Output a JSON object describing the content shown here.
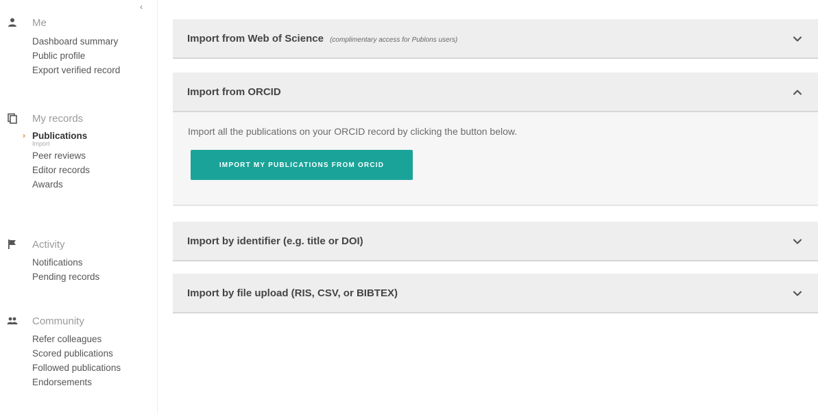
{
  "sidebar": {
    "collapse_glyph": "‹",
    "groups": [
      {
        "label": "Me",
        "icon": "person-icon",
        "items": [
          {
            "label": "Dashboard summary"
          },
          {
            "label": "Public profile"
          },
          {
            "label": "Export verified record"
          }
        ]
      },
      {
        "label": "My records",
        "icon": "records-icon",
        "items": [
          {
            "label": "Publications",
            "active": true,
            "sub": "Import"
          },
          {
            "label": "Peer reviews"
          },
          {
            "label": "Editor records"
          },
          {
            "label": "Awards"
          }
        ]
      },
      {
        "label": "Activity",
        "icon": "flag-icon",
        "items": [
          {
            "label": "Notifications"
          },
          {
            "label": "Pending records"
          }
        ]
      },
      {
        "label": "Community",
        "icon": "people-icon",
        "items": [
          {
            "label": "Refer colleagues"
          },
          {
            "label": "Scored publications"
          },
          {
            "label": "Followed publications"
          },
          {
            "label": "Endorsements"
          }
        ]
      }
    ]
  },
  "accordion": {
    "panels": [
      {
        "title": "Import from Web of Science",
        "note": "(complimentary access for Publons users)",
        "expanded": false,
        "chevron": "chevron-down-icon"
      },
      {
        "title": "Import from ORCID",
        "expanded": true,
        "chevron": "chevron-up-icon",
        "body_text": "Import all the publications on your ORCID record by clicking the button below.",
        "button_label": "IMPORT MY PUBLICATIONS FROM ORCID"
      },
      {
        "title": "Import by identifier (e.g. title or DOI)",
        "expanded": false,
        "chevron": "chevron-down-icon"
      },
      {
        "title": "Import by file upload (RIS, CSV, or BIBTEX)",
        "expanded": false,
        "chevron": "chevron-down-icon"
      }
    ]
  },
  "colors": {
    "accent_button": "#1aa399",
    "active_chevron": "#e8862a",
    "panel_header_bg": "#eeeeee",
    "panel_body_bg": "#f6f6f6"
  }
}
